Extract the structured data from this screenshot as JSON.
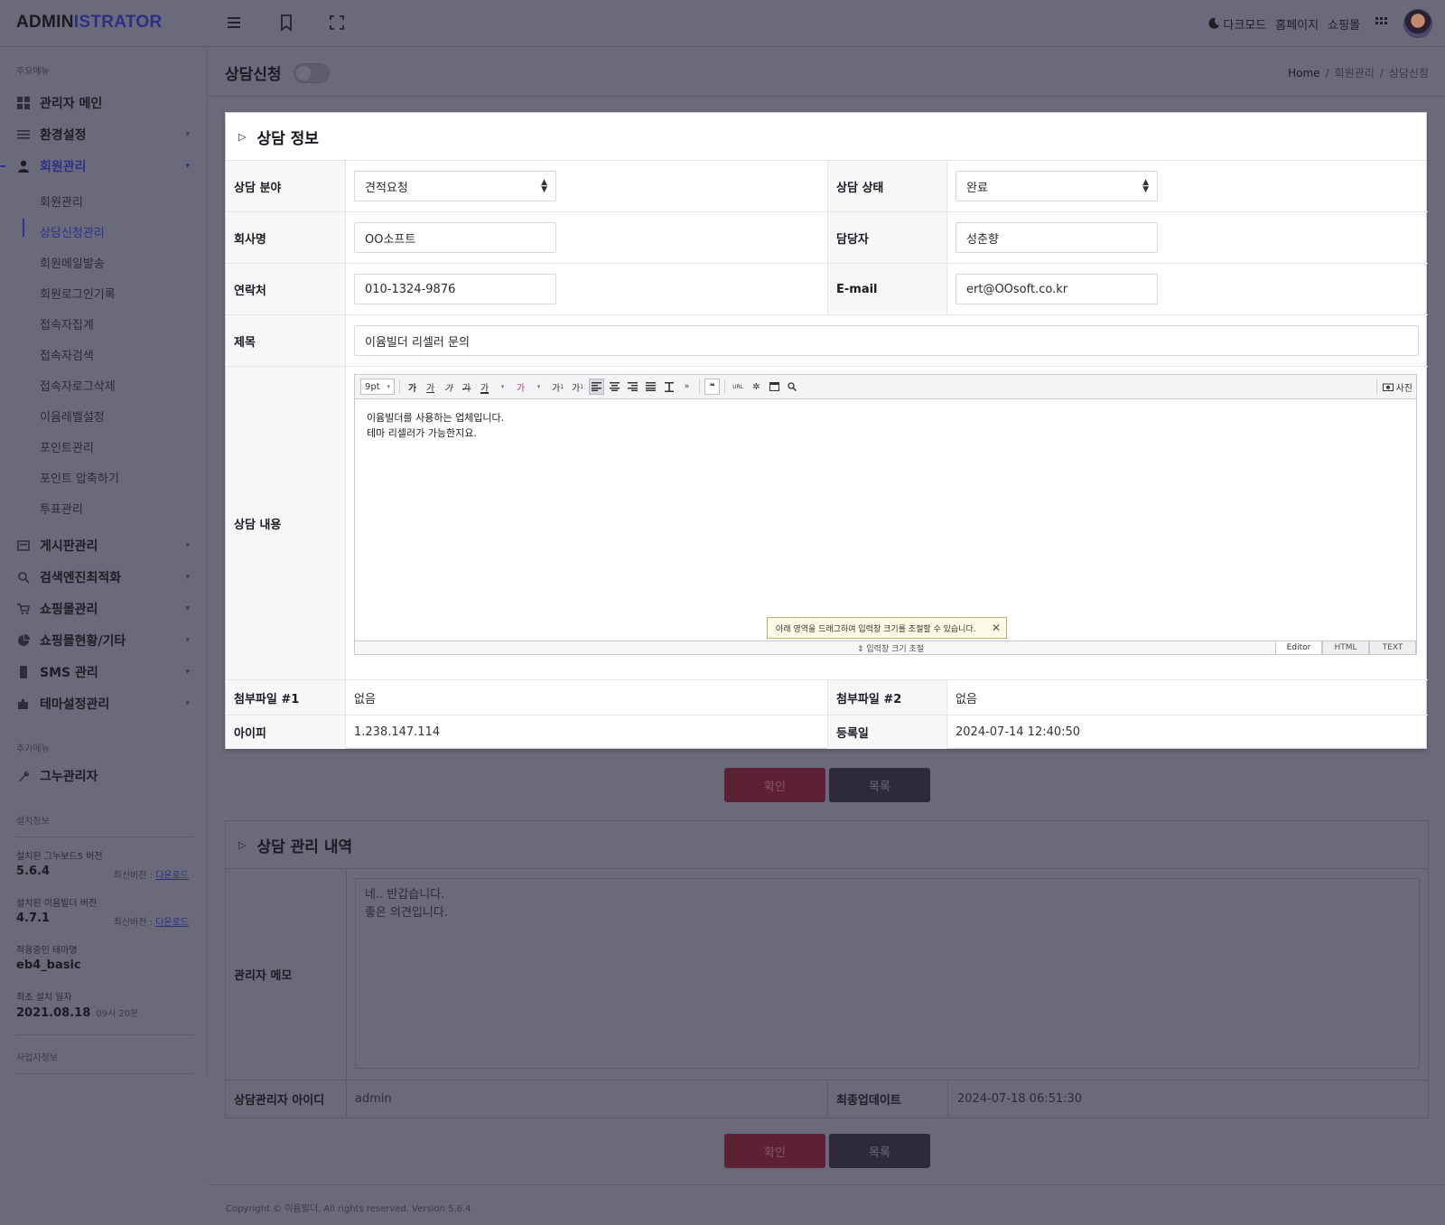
{
  "topbar": {
    "logo_a": "ADMIN",
    "logo_b": "ISTRATOR",
    "dark_mode": "다크모드",
    "homepage": "홈페이지",
    "shop": "쇼핑몰"
  },
  "sidebar": {
    "section_main": "주요메뉴",
    "items": [
      {
        "label": "관리자 메인",
        "icon": "dashboard-icon"
      },
      {
        "label": "환경설정",
        "icon": "settings-icon"
      },
      {
        "label": "회원관리",
        "icon": "user-icon"
      },
      {
        "label": "게시판관리",
        "icon": "board-icon"
      },
      {
        "label": "검색엔진최적화",
        "icon": "search-icon"
      },
      {
        "label": "쇼핑몰관리",
        "icon": "cart-icon"
      },
      {
        "label": "쇼핑몰현황/기타",
        "icon": "pie-chart-icon"
      },
      {
        "label": "SMS 관리",
        "icon": "phone-icon"
      },
      {
        "label": "테마설정관리",
        "icon": "puzzle-icon"
      }
    ],
    "sub_items": [
      "회원관리",
      "상담신청관리",
      "회원메일발송",
      "회원로그인기록",
      "접속자집계",
      "접속자검색",
      "접속자로그삭제",
      "이윰레벨설정",
      "포인트관리",
      "포인트 압축하기",
      "투표관리"
    ],
    "section_extra": "추가메뉴",
    "extra_item": "그누관리자",
    "section_install": "설치정보",
    "gnuboard_label": "설치된 그누보드5 버전",
    "gnuboard_version": "5.6.4",
    "eyoom_label": "설치된 이윰빌더 버전",
    "eyoom_version": "4.7.1",
    "latest_prefix": "최신버전 : ",
    "download": "다운로드",
    "theme_label": "적용중인 테마명",
    "theme_value": "eb4_basic",
    "install_date_label": "최초 설치 일자",
    "install_date": "2021.08.18",
    "install_time": "09시 20분",
    "section_business": "사업자정보"
  },
  "page": {
    "title": "상담신청",
    "breadcrumb": [
      "Home",
      "회원관리",
      "상담신청"
    ]
  },
  "consult": {
    "panel_title": "상담 정보",
    "category_label": "상담 분야",
    "category_value": "견적요청",
    "status_label": "상담 상태",
    "status_value": "완료",
    "company_label": "회사명",
    "company_value": "OO소프트",
    "manager_label": "담당자",
    "manager_value": "성춘향",
    "phone_label": "연락처",
    "phone_value": "010-1324-9876",
    "email_label": "E-mail",
    "email_value": "ert@OOsoft.co.kr",
    "subject_label": "제목",
    "subject_value": "이윰빌더 리셀러 문의",
    "content_label": "상담 내용",
    "content_line1": "이윰빌더를 사용하는 업체입니다.",
    "content_line2": "테마 리셀러가 가능한지요.",
    "file1_label": "첨부파일 #1",
    "file1_value": "없음",
    "file2_label": "첨부파일 #2",
    "file2_value": "없음",
    "ip_label": "아이피",
    "ip_value": "1.238.147.114",
    "regdate_label": "등록일",
    "regdate_value": "2024-07-14 12:40:50"
  },
  "editor": {
    "font_size": "9pt",
    "photo": "사진",
    "tip": "아래 영역을 드래그하여 입력창 크기를 조절할 수 있습니다.",
    "resize": "입력창 크기 조절",
    "tabs": [
      "Editor",
      "HTML",
      "TEXT"
    ]
  },
  "buttons": {
    "confirm": "확인",
    "list": "목록"
  },
  "admin": {
    "panel_title": "상담 관리 내역",
    "memo_label": "관리자 메모",
    "memo_line1": "네.. 반갑습니다.",
    "memo_line2": "좋은 의견입니다.",
    "admin_id_label": "상담관리자 아이디",
    "admin_id_value": "admin",
    "updated_label": "최종업데이트",
    "updated_value": "2024-07-18 06:51:30"
  },
  "footer": {
    "copyright": "Copyright © 이윰빌더. All rights reserved. Version 5.6.4"
  }
}
